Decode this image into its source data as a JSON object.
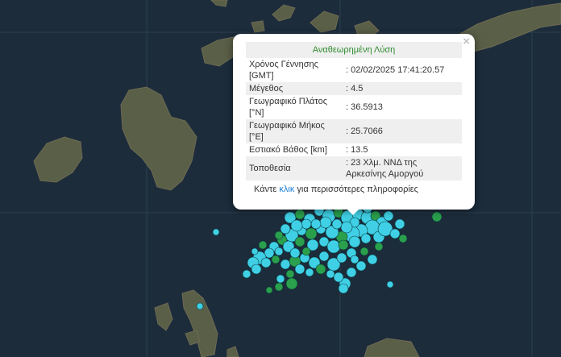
{
  "popup": {
    "title": "Αναθεωρημένη Λύση",
    "close_icon": "×",
    "rows": [
      {
        "label": "Χρόνος Γέννησης [GMT]",
        "value": ": 02/02/2025 17:41:20.57"
      },
      {
        "label": "Μέγεθος",
        "value": ": 4.5"
      },
      {
        "label": "Γεωγραφικό Πλάτος [°N]",
        "value": ": 36.5913"
      },
      {
        "label": "Γεωγραφικό Μήκος [°E]",
        "value": ": 25.7066"
      },
      {
        "label": "Εστιακό Βάθος [km]",
        "value": ": 13.5"
      },
      {
        "label": "Τοποθεσία",
        "value": ": 23 Χλμ. ΝΝΔ της Αρκεσίνης Αμοργού"
      }
    ],
    "footer_prefix": "Κάντε ",
    "footer_link": "κλικ",
    "footer_suffix": " για περισσότερες πληροφορίες"
  },
  "map": {
    "sea_color": "#1b2b3a",
    "land_color": "#5b6148",
    "marker_colors": {
      "cyan": "#3fd0e6",
      "green": "#2aa04c"
    }
  }
}
